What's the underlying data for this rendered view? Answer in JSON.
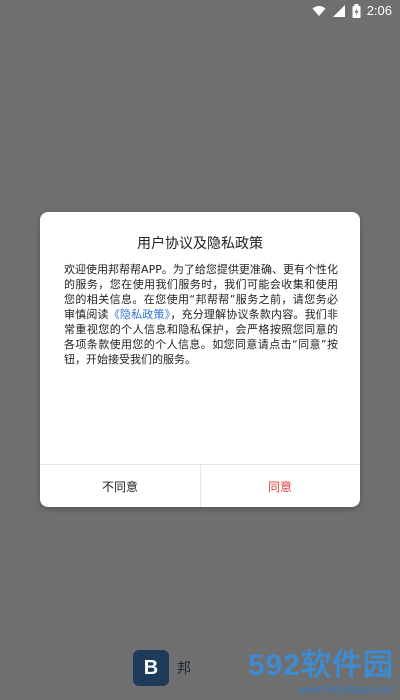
{
  "status_bar": {
    "time": "2:06",
    "icons": [
      "wifi-icon",
      "signal-icon",
      "battery-icon"
    ],
    "icon_color": "#ffffff"
  },
  "dialog": {
    "title": "用户协议及隐私政策",
    "body_part1": "欢迎使用邦帮帮APP。为了给您提供更准确、更有个性化的服务，您在使用我们服务时，我们可能会收集和使用您的相关信息。在您使用“邦帮帮”服务之前，请您务必审慎阅读",
    "privacy_link": "《隐私政策》",
    "body_part2": "，充分理解协议条款内容。我们非常重视您的个人信息和隐私保护，会严格按照您同意的各项条款使用您的个人信息。如您同意请点击“同意”按钮，开始接受我们的服务。",
    "disagree_label": "不同意",
    "agree_label": "同意",
    "colors": {
      "link": "#2f74d0",
      "agree": "#e0413d",
      "overlay": "#6f6f6f"
    }
  },
  "app": {
    "name": "邦",
    "logo_letter": "B",
    "logo_color": "#1e3c5a"
  },
  "watermark": {
    "brand": "592软件园",
    "url": "www.592xiazai.com"
  }
}
